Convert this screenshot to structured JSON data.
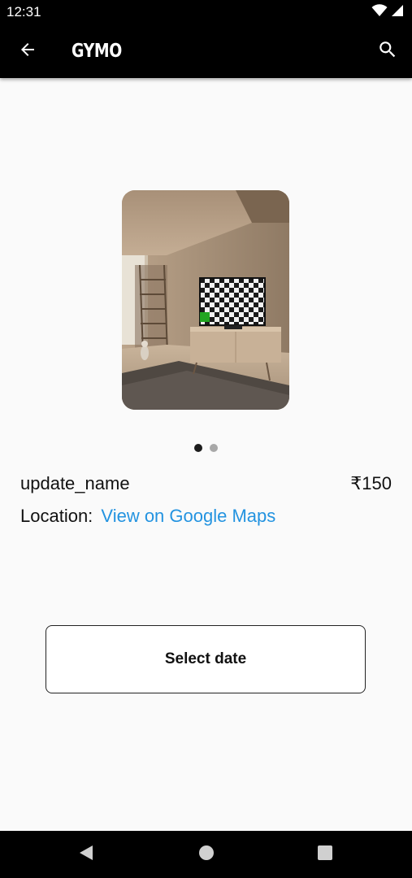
{
  "status_bar": {
    "time": "12:31",
    "icons": [
      "wifi-icon",
      "signal-icon",
      "battery-icon"
    ]
  },
  "app_bar": {
    "title": "GYMO",
    "back_icon": "arrow-left-icon",
    "search_icon": "search-icon",
    "background": "#000000"
  },
  "carousel": {
    "image_description_icon": "room-photo",
    "page_count": 2,
    "active_page": 1
  },
  "listing": {
    "name": "update_name",
    "price": "₹150",
    "location_label": "Location:",
    "location_link": "View on Google Maps",
    "link_color": "#2393e0"
  },
  "actions": {
    "select_date_label": "Select date"
  },
  "nav_bar": {
    "icons": [
      "back-triangle-icon",
      "home-circle-icon",
      "recents-square-icon"
    ]
  }
}
